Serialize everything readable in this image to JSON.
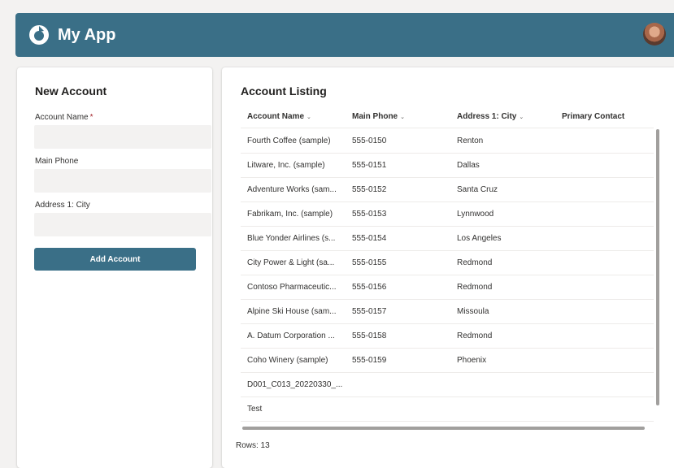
{
  "app": {
    "title": "My App",
    "brand_color": "#3a6f87"
  },
  "new_account": {
    "title": "New Account",
    "fields": [
      {
        "label": "Account Name",
        "required_mark": "*",
        "value": ""
      },
      {
        "label": "Main Phone",
        "value": ""
      },
      {
        "label": "Address 1: City",
        "value": ""
      }
    ],
    "add_button": "Add Account"
  },
  "listing": {
    "title": "Account Listing",
    "columns": [
      {
        "label": "Account Name",
        "icon": "chevron-down-icon"
      },
      {
        "label": "Main Phone",
        "icon": "chevron-down-icon"
      },
      {
        "label": "Address 1: City",
        "icon": "chevron-down-icon"
      },
      {
        "label": "Primary Contact"
      }
    ],
    "rows": [
      [
        "Fourth Coffee (sample)",
        "555-0150",
        "Renton",
        ""
      ],
      [
        "Litware, Inc. (sample)",
        "555-0151",
        "Dallas",
        ""
      ],
      [
        "Adventure Works (sam...",
        "555-0152",
        "Santa Cruz",
        ""
      ],
      [
        "Fabrikam, Inc. (sample)",
        "555-0153",
        "Lynnwood",
        ""
      ],
      [
        "Blue Yonder Airlines (s...",
        "555-0154",
        "Los Angeles",
        ""
      ],
      [
        "City Power & Light (sa...",
        "555-0155",
        "Redmond",
        ""
      ],
      [
        "Contoso Pharmaceutic...",
        "555-0156",
        "Redmond",
        ""
      ],
      [
        "Alpine Ski House (sam...",
        "555-0157",
        "Missoula",
        ""
      ],
      [
        "A. Datum Corporation ...",
        "555-0158",
        "Redmond",
        ""
      ],
      [
        "Coho Winery (sample)",
        "555-0159",
        "Phoenix",
        ""
      ],
      [
        "D001_C013_20220330_...",
        "",
        "",
        ""
      ],
      [
        "Test",
        "",
        "",
        ""
      ]
    ],
    "rows_count": "Rows: 13"
  }
}
